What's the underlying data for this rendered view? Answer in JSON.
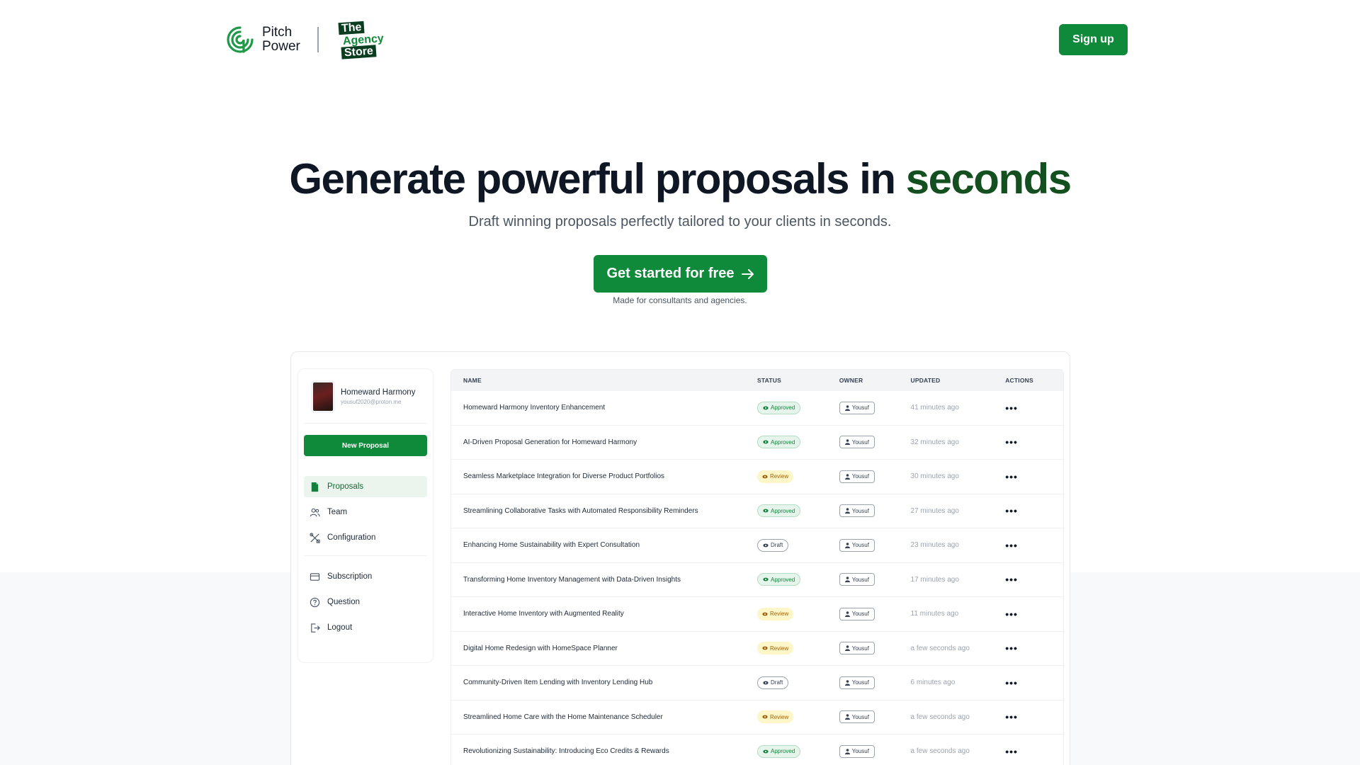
{
  "header": {
    "brand_line1": "Pitch",
    "brand_line2": "Power",
    "agency_line1": "The",
    "agency_line2": "Agency",
    "agency_line3": "Store",
    "signup_label": "Sign up"
  },
  "hero": {
    "title_main": "Generate powerful proposals in",
    "title_accent": "seconds",
    "subtitle": "Draft winning proposals perfectly tailored to your clients in seconds.",
    "cta_label": "Get started for free",
    "cta_note": "Made for consultants and agencies."
  },
  "colors": {
    "accent": "#0e8a3a",
    "accent_dark": "#14501f"
  },
  "sidebar": {
    "profile_name": "Homeward Harmony",
    "profile_email": "yousuf2020@proton.me",
    "new_proposal_label": "New Proposal",
    "nav": [
      {
        "label": "Proposals",
        "icon": "file-icon"
      },
      {
        "label": "Team",
        "icon": "users-icon"
      },
      {
        "label": "Configuration",
        "icon": "tools-icon"
      }
    ],
    "nav_secondary": [
      {
        "label": "Subscription",
        "icon": "card-icon"
      },
      {
        "label": "Question",
        "icon": "question-icon"
      },
      {
        "label": "Logout",
        "icon": "logout-icon"
      }
    ]
  },
  "table": {
    "headers": {
      "name": "NAME",
      "status": "STATUS",
      "owner": "OWNER",
      "updated": "UPDATED",
      "actions": "ACTIONS"
    },
    "rows": [
      {
        "name": "Homeward Harmony Inventory Enhancement",
        "status": "Approved",
        "owner": "Yousuf",
        "updated": "41 minutes ago"
      },
      {
        "name": "AI-Driven Proposal Generation for Homeward Harmony",
        "status": "Approved",
        "owner": "Yousuf",
        "updated": "32 minutes ago"
      },
      {
        "name": "Seamless Marketplace Integration for Diverse Product Portfolios",
        "status": "Review",
        "owner": "Yousuf",
        "updated": "30 minutes ago"
      },
      {
        "name": "Streamlining Collaborative Tasks with Automated Responsibility Reminders",
        "status": "Approved",
        "owner": "Yousuf",
        "updated": "27 minutes ago"
      },
      {
        "name": "Enhancing Home Sustainability with Expert Consultation",
        "status": "Draft",
        "owner": "Yousuf",
        "updated": "23 minutes ago"
      },
      {
        "name": "Transforming Home Inventory Management with Data-Driven Insights",
        "status": "Approved",
        "owner": "Yousuf",
        "updated": "17 minutes ago"
      },
      {
        "name": "Interactive Home Inventory with Augmented Reality",
        "status": "Review",
        "owner": "Yousuf",
        "updated": "11 minutes ago"
      },
      {
        "name": "Digital Home Redesign with HomeSpace Planner",
        "status": "Review",
        "owner": "Yousuf",
        "updated": "a few seconds ago"
      },
      {
        "name": "Community-Driven Item Lending with Inventory Lending Hub",
        "status": "Draft",
        "owner": "Yousuf",
        "updated": "6 minutes ago"
      },
      {
        "name": "Streamlined Home Care with the Home Maintenance Scheduler",
        "status": "Review",
        "owner": "Yousuf",
        "updated": "a few seconds ago"
      },
      {
        "name": "Revolutionizing Sustainability: Introducing Eco Credits & Rewards",
        "status": "Approved",
        "owner": "Yousuf",
        "updated": "a few seconds ago"
      }
    ],
    "actions_glyph": "•••"
  }
}
